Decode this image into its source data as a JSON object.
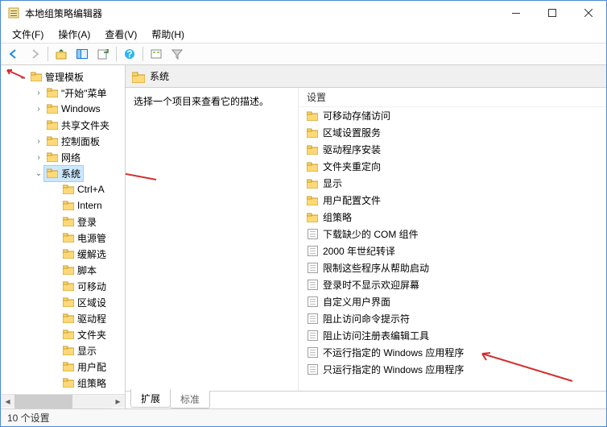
{
  "window": {
    "title": "本地组策略编辑器"
  },
  "menu": {
    "file": "文件(F)",
    "action": "操作(A)",
    "view": "查看(V)",
    "help": "帮助(H)"
  },
  "tree": {
    "root": "管理模板",
    "items": [
      "\"开始\"菜单",
      "Windows",
      "共享文件夹",
      "控制面板",
      "网络",
      "系统"
    ],
    "system_children": [
      "Ctrl+A",
      "Intern",
      "登录",
      "电源管",
      "缓解选",
      "脚本",
      "可移动",
      "区域设",
      "驱动程",
      "文件夹",
      "显示",
      "用户配",
      "组策略"
    ]
  },
  "path": {
    "label": "系统"
  },
  "desc": {
    "hint": "选择一个项目来查看它的描述。"
  },
  "list": {
    "header": "设置",
    "folders": [
      "可移动存储访问",
      "区域设置服务",
      "驱动程序安装",
      "文件夹重定向",
      "显示",
      "用户配置文件",
      "组策略"
    ],
    "settings": [
      "下载缺少的 COM 组件",
      "2000 年世纪转译",
      "限制这些程序从帮助启动",
      "登录时不显示欢迎屏幕",
      "自定义用户界面",
      "阻止访问命令提示符",
      "阻止访问注册表编辑工具",
      "不运行指定的 Windows 应用程序",
      "只运行指定的 Windows 应用程序"
    ]
  },
  "tabs": {
    "extended": "扩展",
    "standard": "标准"
  },
  "status": {
    "text": "10 个设置"
  }
}
